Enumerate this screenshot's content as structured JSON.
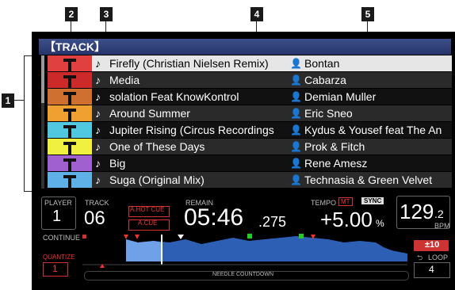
{
  "callouts": [
    "1",
    "2",
    "3",
    "4",
    "5"
  ],
  "header": {
    "label": "【TRACK】"
  },
  "tracks": [
    {
      "title": "Firefly (Christian Nielsen Remix)",
      "artist": "Bontan",
      "art_color": "#e04040"
    },
    {
      "title": "Media",
      "artist": "Cabarza",
      "art_color": "#cc2a2a"
    },
    {
      "title": "solation Feat KnowKontrol",
      "artist": "Demian Muller",
      "art_color": "#d07030"
    },
    {
      "title": "Around Summer",
      "artist": "Eric Sneo",
      "art_color": "#f0a030"
    },
    {
      "title": "Jupiter Rising (Circus Recordings",
      "artist": "Kydus & Yousef feat The An",
      "art_color": "#50c8e0"
    },
    {
      "title": "One of These Days",
      "artist": "Prok & Fitch",
      "art_color": "#f0f040"
    },
    {
      "title": "Big",
      "artist": "Rene Amesz",
      "art_color": "#a060d0"
    },
    {
      "title": "Suga (Original Mix)",
      "artist": "Technasia & Green Velvet",
      "art_color": "#60b0e8"
    }
  ],
  "player": {
    "label": "PLAYER",
    "number": "1"
  },
  "track": {
    "label": "TRACK",
    "number": "06"
  },
  "hot_cue": {
    "label": "A.HOT CUE"
  },
  "a_cue": {
    "label": "A.CUE"
  },
  "remain": {
    "label": "REMAIN",
    "time": "05:46",
    "ms": ".275"
  },
  "tempo": {
    "label": "TEMPO",
    "mt": "MT",
    "sync": "SYNC",
    "value": "+5.00",
    "unit": "%"
  },
  "bpm": {
    "value": "129",
    "decimal": ".2",
    "label": "BPM"
  },
  "continue": {
    "label": "CONTINUE"
  },
  "quantize": {
    "label": "QUANTIZE",
    "value": "1"
  },
  "needle": {
    "label": "NEEDLE COUNTDOWN"
  },
  "range": {
    "value": "±10"
  },
  "loop": {
    "label": "LOOP",
    "value": "4"
  }
}
